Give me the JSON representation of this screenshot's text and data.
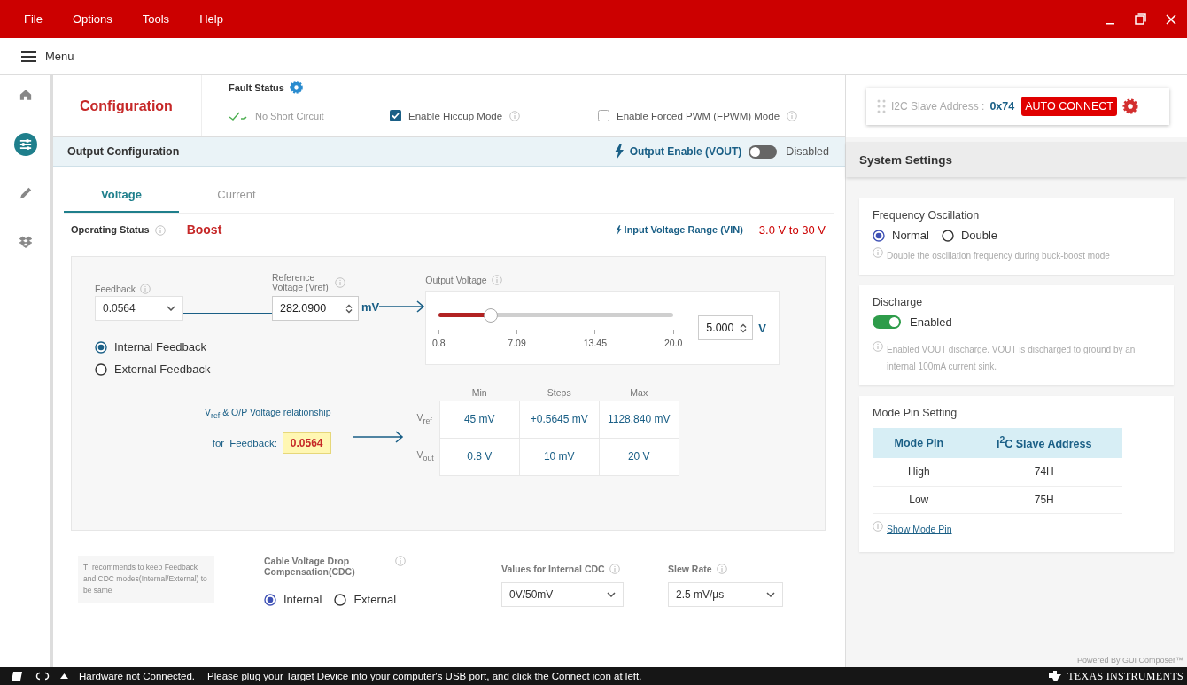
{
  "menubar": {
    "items": [
      "File",
      "Options",
      "Tools",
      "Help"
    ]
  },
  "menu_toggle": {
    "label": "Menu"
  },
  "sidebar": {
    "items": [
      {
        "kind": "home",
        "selected": false
      },
      {
        "kind": "sliders",
        "selected": true
      },
      {
        "kind": "pencil",
        "selected": false
      },
      {
        "kind": "boxes",
        "selected": false
      }
    ]
  },
  "header": {
    "title": "Configuration",
    "fault_status": {
      "label": "Fault Status",
      "short_circuit": "No Short Circuit"
    },
    "options": [
      {
        "label": "Enable Hiccup Mode",
        "checked": true
      },
      {
        "label": "Enable Forced PWM (FPWM) Mode",
        "checked": false
      }
    ]
  },
  "connection": {
    "label": "I2C Slave Address :",
    "address": "0x74",
    "button": "AUTO CONNECT"
  },
  "output_configuration": {
    "title": "Output Configuration",
    "output_enable": {
      "label": "Output Enable (VOUT)",
      "on": false,
      "state": "Disabled"
    }
  },
  "tabs": [
    {
      "label": "Voltage",
      "selected": true
    },
    {
      "label": "Current",
      "selected": false
    }
  ],
  "operating_status": {
    "label": "Operating Status",
    "value": "Boost"
  },
  "input_voltage_range": {
    "label": "Input Voltage Range (VIN)",
    "value": "3.0 V to 30 V"
  },
  "feedback": {
    "label": "Feedback",
    "value": "0.0564"
  },
  "reference_voltage": {
    "label": "Reference Voltage (Vref)",
    "value": "282.0900",
    "unit": "mV"
  },
  "output_voltage": {
    "label": "Output Voltage",
    "level": 0.22,
    "ticks": [
      "0.8",
      "7.09",
      "13.45",
      "20.0"
    ],
    "value": "5.000",
    "unit": "V"
  },
  "feedback_mode": [
    {
      "label": "Internal Feedback",
      "selected": true
    },
    {
      "label": "External Feedback",
      "selected": false
    }
  ],
  "relationship": {
    "caption": "V$_{ref}$ & O/P Voltage relationship",
    "for_label": "for",
    "feedback_label": "Feedback:",
    "feedback": "0.0564",
    "columns": [
      "Min",
      "Steps",
      "Max"
    ],
    "rows": [
      {
        "label": "V$_{ref}$",
        "cells": [
          "45 mV",
          "+0.5645 mV",
          "1128.840 mV"
        ]
      },
      {
        "label": "V$_{out}$",
        "cells": [
          "0.8 V",
          "10 mV",
          "20 V"
        ]
      }
    ]
  },
  "note": "TI recommends to keep Feedback and CDC modes(Internal/External) to be same",
  "cdc": {
    "label": "Cable Voltage Drop Compensation(CDC)",
    "options": [
      {
        "label": "Internal",
        "selected": true
      },
      {
        "label": "External",
        "selected": false
      }
    ]
  },
  "internal_cdc": {
    "label": "Values for Internal CDC",
    "value": "0V/50mV"
  },
  "slew_rate": {
    "label": "Slew Rate",
    "value": "2.5 mV/µs"
  },
  "system_settings": {
    "title": "System Settings",
    "frequency": {
      "title": "Frequency Oscillation",
      "options": [
        {
          "label": "Normal",
          "selected": true
        },
        {
          "label": "Double",
          "selected": false
        }
      ],
      "hint": "Double the oscillation frequency during buck-boost mode"
    },
    "discharge": {
      "title": "Discharge",
      "on": true,
      "state": "Enabled",
      "hint": "Enabled VOUT discharge. VOUT is discharged to ground by an internal 100mA current sink."
    },
    "mode_pin": {
      "title": "Mode Pin Setting",
      "columns": [
        "Mode Pin",
        "I$^{2}$C Slave Address"
      ],
      "rows": [
        [
          "High",
          "74H"
        ],
        [
          "Low",
          "75H"
        ]
      ],
      "link": "Show Mode Pin"
    }
  },
  "powered_by": "Powered By GUI Composer™",
  "status_bar": {
    "message": "Hardware not Connected.",
    "hint": "Please plug your Target Device into your computer's USB port, and click the Connect icon at left.",
    "brand": "TEXAS INSTRUMENTS"
  }
}
